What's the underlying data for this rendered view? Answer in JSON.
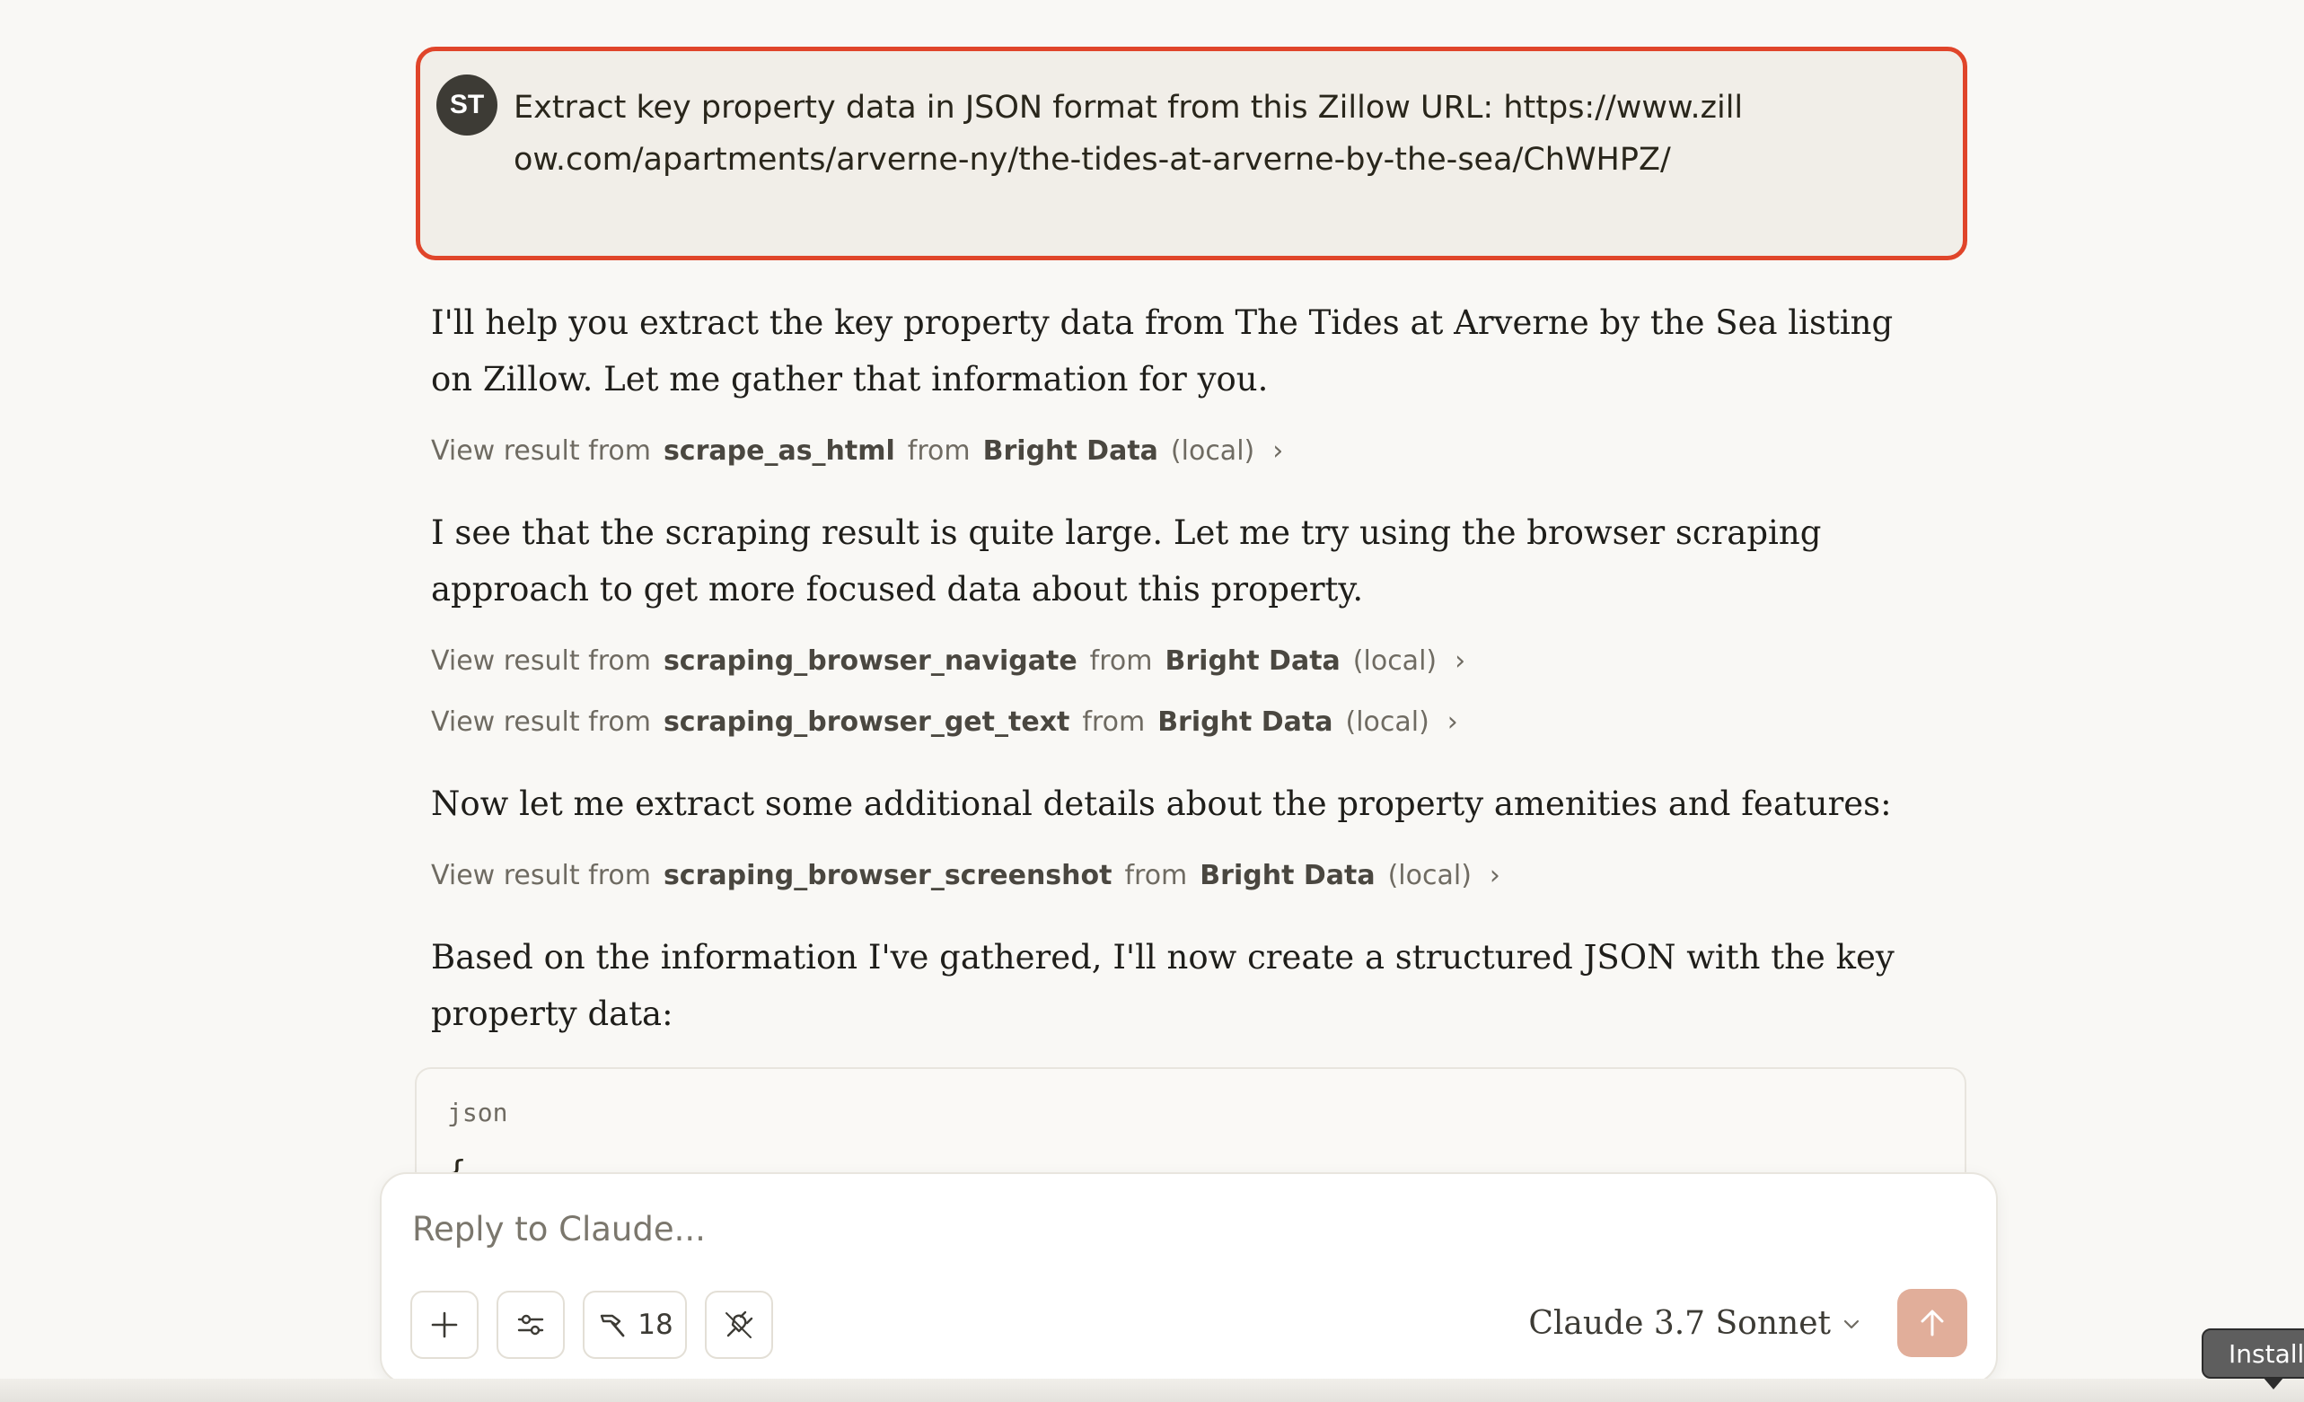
{
  "user_message": {
    "avatar_initials": "ST",
    "text": "Extract key property data in JSON format from this Zillow URL: https://www.zillow.com/apartments/arverne-ny/the-tides-at-arverne-by-the-sea/ChWHPZ/"
  },
  "assistant": {
    "para1": "I'll help you extract the key property data from The Tides at Arverne by the Sea listing on Zillow. Let me gather that information for you.",
    "tool1": {
      "prefix": "View result from",
      "tool": "scrape_as_html",
      "from": "from",
      "source": "Bright Data",
      "suffix": "(local)"
    },
    "para2": "I see that the scraping result is quite large. Let me try using the browser scraping approach to get more focused data about this property.",
    "tool2": {
      "prefix": "View result from",
      "tool": "scraping_browser_navigate",
      "from": "from",
      "source": "Bright Data",
      "suffix": "(local)"
    },
    "tool3": {
      "prefix": "View result from",
      "tool": "scraping_browser_get_text",
      "from": "from",
      "source": "Bright Data",
      "suffix": "(local)"
    },
    "para3": "Now let me extract some additional details about the property amenities and features:",
    "tool4": {
      "prefix": "View result from",
      "tool": "scraping_browser_screenshot",
      "from": "from",
      "source": "Bright Data",
      "suffix": "(local)"
    },
    "para4": "Based on the information I've gathered, I'll now create a structured JSON with the key property data:",
    "code": {
      "language": "json",
      "first_line": "{"
    }
  },
  "composer": {
    "placeholder": "Reply to Claude...",
    "tools_count": "18",
    "model_name": "Claude 3.7 Sonnet"
  },
  "tooltip": {
    "text": "Installed"
  },
  "colors": {
    "background": "#f9f8f5",
    "highlight_border": "#e0452a",
    "send_button": "#e1ae9a"
  },
  "icons": [
    "plus-icon",
    "sliders-icon",
    "hammer-icon",
    "plug-icon",
    "chevron-down-icon",
    "arrow-up-icon",
    "chevron-right-icon"
  ]
}
